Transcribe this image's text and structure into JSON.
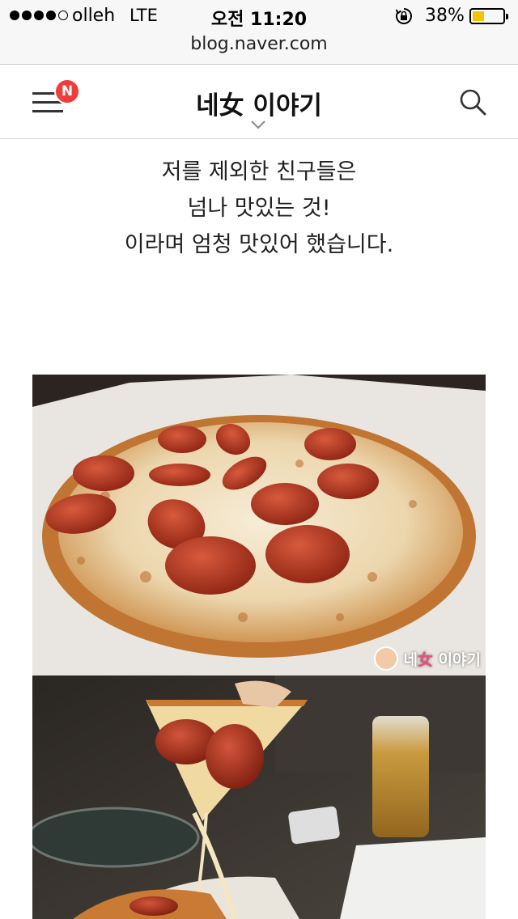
{
  "status_bar": {
    "carrier": "olleh",
    "network": "LTE",
    "time": "오전 11:20",
    "battery_percent": "38%",
    "battery_level": 0.38,
    "battery_color": "#f5c400"
  },
  "browser": {
    "url": "blog.naver.com"
  },
  "header": {
    "menu_icon": "hamburger-menu-icon",
    "new_badge": "N",
    "badge_color": "#f03c3c",
    "title": "네女 이야기",
    "dropdown_icon": "chevron-down-icon",
    "search_icon": "search-icon"
  },
  "post": {
    "lines": [
      "저를 제외한 친구들은",
      "넘나 맛있는 것!",
      "이라며 엄청 맛있어 했습니다."
    ],
    "images": [
      {
        "name": "pepperoni-pizza-photo",
        "watermark": "네女 이야기"
      },
      {
        "name": "pizza-slice-cheese-pull-photo"
      }
    ]
  }
}
